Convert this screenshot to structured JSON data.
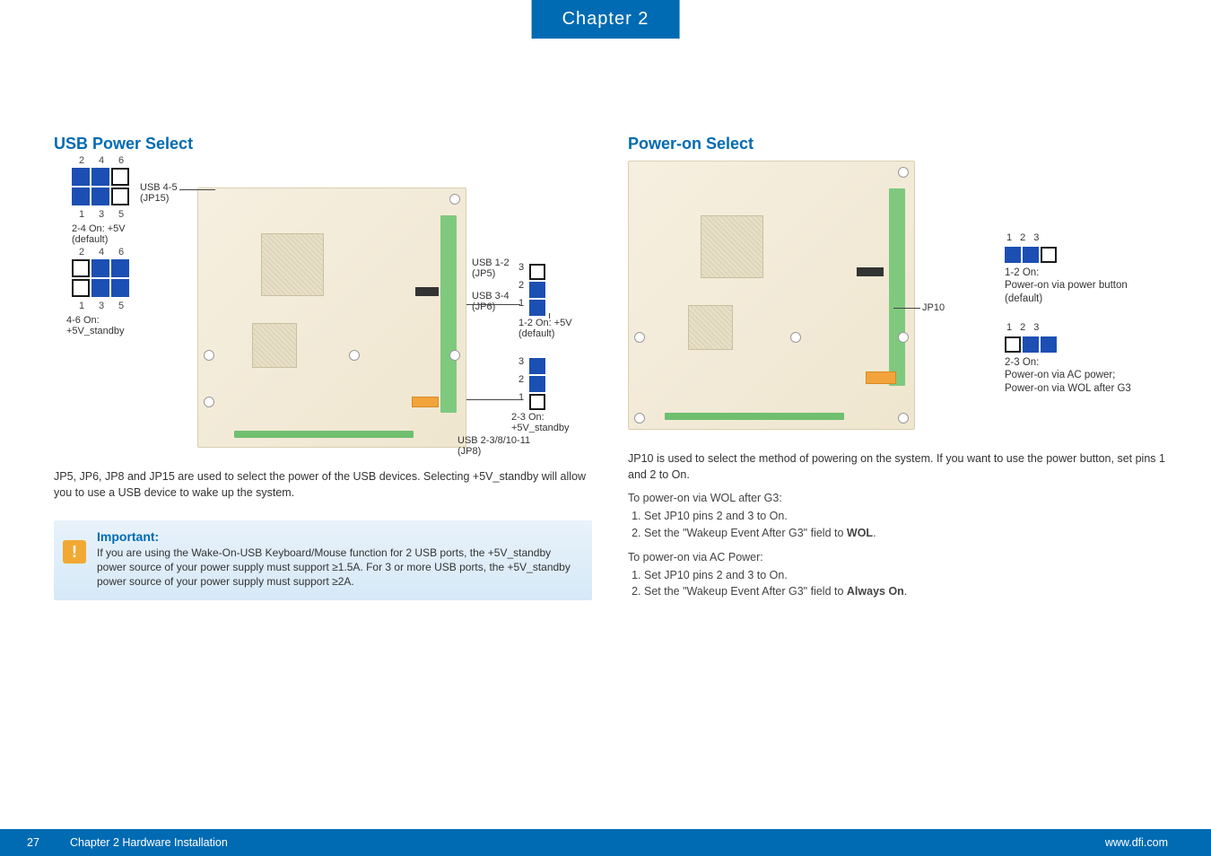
{
  "chapter_tab": "Chapter 2",
  "page_number": "27",
  "footer_left": "Chapter 2 Hardware Installation",
  "footer_right": "www.dfi.com",
  "left": {
    "title": "USB Power Select",
    "jp15": {
      "name": "USB 4-5",
      "sub": "(JP15)",
      "nums_top": [
        "2",
        "4",
        "6"
      ],
      "nums_bot": [
        "1",
        "3",
        "5"
      ],
      "caption1": "2-4 On: +5V",
      "caption2": "(default)"
    },
    "jp15b": {
      "nums_top": [
        "2",
        "4",
        "6"
      ],
      "nums_bot": [
        "1",
        "3",
        "5"
      ],
      "caption1": "4-6 On:",
      "caption2": "+5V_standby"
    },
    "jp5": {
      "name": "USB 1-2",
      "sub": "(JP5)"
    },
    "jp6": {
      "name": "USB 3-4",
      "sub": "(JP6)"
    },
    "jp8": {
      "name": "USB 2-3/8/10-11",
      "sub": "(JP8)"
    },
    "vjumper_nums": [
      "3",
      "2",
      "1"
    ],
    "vopt1a": "1-2 On: +5V",
    "vopt1b": "(default)",
    "vopt2a": "2-3 On:",
    "vopt2b": "+5V_standby",
    "paragraph": "JP5, JP6, JP8 and JP15 are used to select the power of the USB devices. Selecting +5V_standby will allow you to use a USB device to wake up the system.",
    "important_title": "Important:",
    "important_text": "If you are using the Wake-On-USB Keyboard/Mouse function for 2 USB ports, the +5V_standby power source of your power supply must support ≥1.5A. For 3 or more USB ports, the +5V_standby power source of your power supply must support ≥2A."
  },
  "right": {
    "title": "Power-on Select",
    "jp10_label": "JP10",
    "optA": {
      "nums": [
        "1",
        "2",
        "3"
      ],
      "line1": "1-2 On:",
      "line2": "Power-on via power button",
      "line3": "(default)"
    },
    "optB": {
      "nums": [
        "1",
        "2",
        "3"
      ],
      "line1": "2-3 On:",
      "line2": "Power-on via AC power;",
      "line3": "Power-on via WOL after G3"
    },
    "para1": "JP10 is used to select the method of powering on the system. If you want to use the power button, set pins 1 and 2 to On.",
    "sub1": "To power-on via WOL after G3:",
    "steps1": [
      "Set JP10 pins 2 and 3 to On.",
      "Set the \"Wakeup Event After G3\" field to ",
      "."
    ],
    "steps1_bold": "WOL",
    "sub2": "To power-on via AC Power:",
    "steps2": [
      "Set JP10 pins 2 and 3 to On.",
      "Set the \"Wakeup Event After G3\" field to ",
      "."
    ],
    "steps2_bold": "Always On"
  }
}
